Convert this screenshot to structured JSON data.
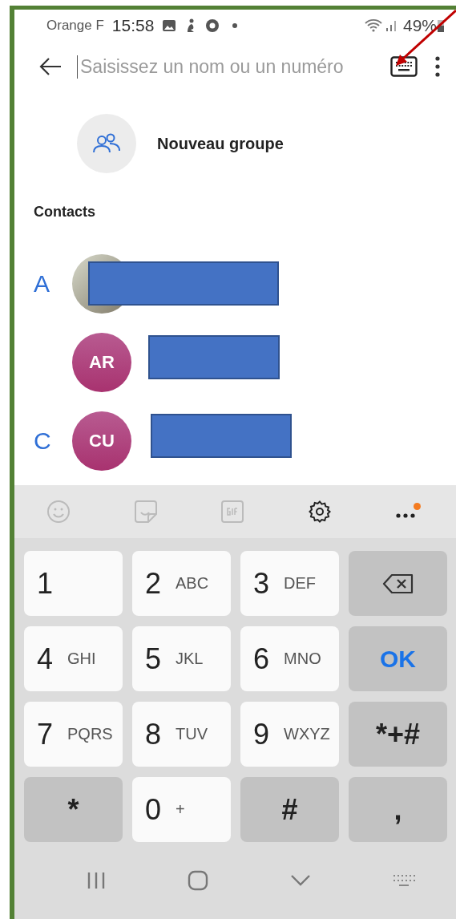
{
  "status_bar": {
    "carrier": "Orange F",
    "time": "15:58",
    "battery": "49%"
  },
  "search": {
    "placeholder": "Saisissez un nom ou un numéro"
  },
  "new_group": {
    "label": "Nouveau groupe"
  },
  "contacts": {
    "heading": "Contacts",
    "rows": [
      {
        "index": "A",
        "kind": "photo"
      },
      {
        "kind": "initials",
        "initials": "AR"
      },
      {
        "index": "C",
        "kind": "initials",
        "initials": "CU"
      }
    ]
  },
  "keyboard_toolbar": {
    "more_badge": true
  },
  "keys": [
    {
      "kind": "digit",
      "main": "1"
    },
    {
      "kind": "digit",
      "main": "2",
      "sub": "ABC"
    },
    {
      "kind": "digit",
      "main": "3",
      "sub": "DEF"
    },
    {
      "kind": "backspace"
    },
    {
      "kind": "digit",
      "main": "4",
      "sub": "GHI"
    },
    {
      "kind": "digit",
      "main": "5",
      "sub": "JKL"
    },
    {
      "kind": "digit",
      "main": "6",
      "sub": "MNO"
    },
    {
      "kind": "ok",
      "main": "OK"
    },
    {
      "kind": "digit",
      "main": "7",
      "sub": "PQRS"
    },
    {
      "kind": "digit",
      "main": "8",
      "sub": "TUV"
    },
    {
      "kind": "digit",
      "main": "9",
      "sub": "WXYZ"
    },
    {
      "kind": "symbol",
      "main": "*+#"
    },
    {
      "kind": "symbol",
      "main": "*"
    },
    {
      "kind": "digit",
      "main": "0",
      "sub": "+"
    },
    {
      "kind": "symbol",
      "main": "#"
    },
    {
      "kind": "symbol",
      "main": ","
    }
  ]
}
